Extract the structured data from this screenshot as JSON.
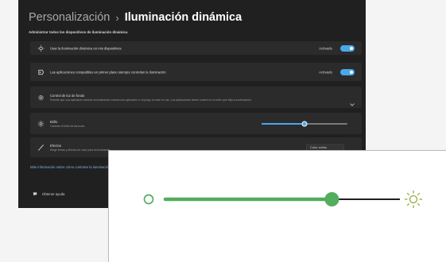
{
  "header": {
    "parent": "Personalización",
    "separator": "›",
    "title": "Iluminación dinámica"
  },
  "section_heading": "Administrar todos los dispositivos de iluminación dinámica",
  "settings": {
    "dynamic_lighting": {
      "label": "Usar la iluminación dinámica en mis dispositivos",
      "state_label": "Activado",
      "enabled": true,
      "icon": "lightbulb-icon"
    },
    "foreground_apps": {
      "label": "Las aplicaciones compatibles en primer plano siempre controlan la iluminación",
      "state_label": "Activado",
      "enabled": true,
      "icon": "app-control-icon"
    },
    "background_control": {
      "title": "Control de luz de fondo",
      "subtitle": "Permitir que una aplicación controle la iluminación cuando una aplicación o un juego no esté en uso. Las aplicaciones tienen control en el orden que elija a continuación.",
      "icon": "gear-icon"
    },
    "brightness": {
      "title": "Brillo",
      "subtitle": "Cambiar el brillo de las luces",
      "level_percent": 50,
      "icon": "brightness-icon"
    },
    "effects": {
      "title": "Efectos",
      "subtitle": "Elegir temas y efectos de color para la iluminación",
      "selected_option": "Color sólido",
      "icon": "brush-icon"
    }
  },
  "footer_link": "Más información sobre cómo controlar la iluminación dinámica",
  "help": {
    "label": "Obtener ayuda",
    "icon": "help-icon"
  },
  "zoom": {
    "brightness_level_percent": 71,
    "low_icon": "brightness-low-icon",
    "high_icon": "brightness-high-icon"
  },
  "colors": {
    "accent": "#4aa8e8",
    "window_bg": "#202020",
    "card_bg": "#2b2b2b",
    "zoom_slider_accent": "#52ad5d",
    "zoom_track": "#1f1f1f"
  }
}
